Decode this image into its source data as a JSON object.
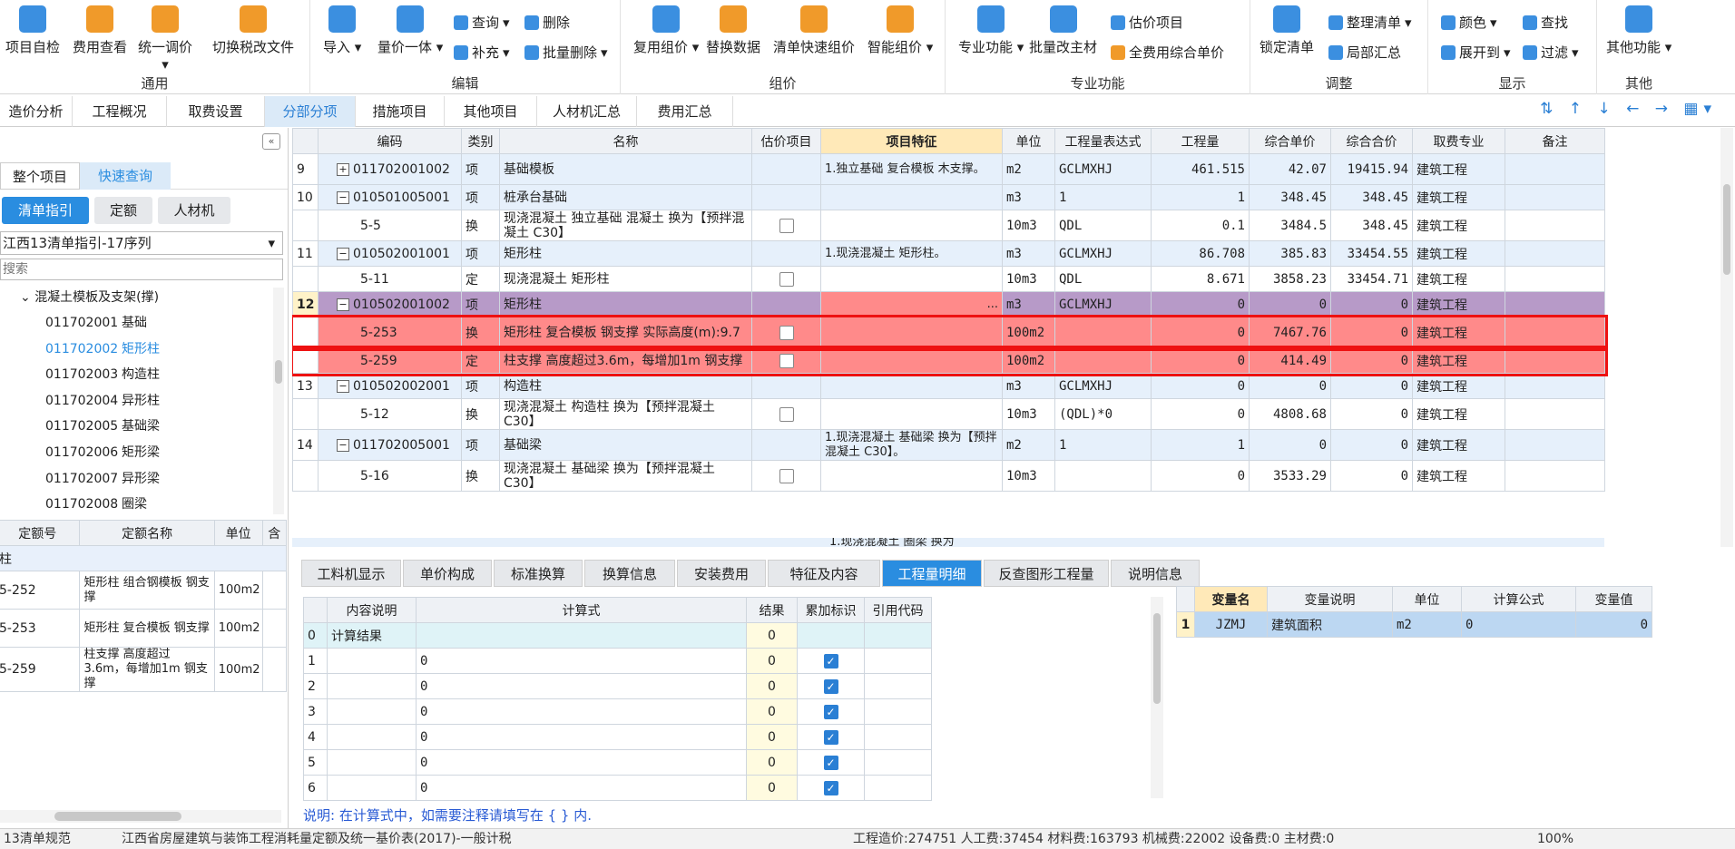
{
  "ribbon": {
    "groups": [
      {
        "label": "通用",
        "buttons": [
          "项目自检",
          "费用查看",
          "统一调价",
          "切换税改文件"
        ]
      },
      {
        "label": "编辑",
        "buttons": [
          "导入",
          "量价一体",
          "查询",
          "删除",
          "补充",
          "批量删除"
        ]
      },
      {
        "label": "组价",
        "buttons": [
          "复用组价",
          "替换数据",
          "清单快速组价",
          "智能组价"
        ]
      },
      {
        "label": "专业功能",
        "buttons": [
          "专业功能",
          "批量改主材",
          "估价项目",
          "全费用综合单价"
        ]
      },
      {
        "label": "调整",
        "buttons": [
          "锁定清单",
          "整理清单",
          "局部汇总"
        ]
      },
      {
        "label": "显示",
        "buttons": [
          "颜色",
          "查找",
          "展开到",
          "过滤"
        ]
      },
      {
        "label": "其他",
        "buttons": [
          "其他功能"
        ]
      }
    ]
  },
  "tabs": [
    "造价分析",
    "工程概况",
    "取费设置",
    "分部分项",
    "措施项目",
    "其他项目",
    "人材机汇总",
    "费用汇总"
  ],
  "left": {
    "toptabs": [
      "整个项目",
      "快速查询"
    ],
    "subtabs": [
      "清单指引",
      "定额",
      "人材机"
    ],
    "select": "江西13清单指引-17序列",
    "search_placeholder": "搜索",
    "tree_root": "混凝土模板及支架(撑)",
    "tree_items": [
      {
        "code": "011702001",
        "name": "基础"
      },
      {
        "code": "011702002",
        "name": "矩形柱"
      },
      {
        "code": "011702003",
        "name": "构造柱"
      },
      {
        "code": "011702004",
        "name": "异形柱"
      },
      {
        "code": "011702005",
        "name": "基础梁"
      },
      {
        "code": "011702006",
        "name": "矩形梁"
      },
      {
        "code": "011702007",
        "name": "异形梁"
      },
      {
        "code": "011702008",
        "name": "圈梁"
      }
    ],
    "quota_headers": [
      "定额号",
      "定额名称",
      "单位",
      "含"
    ],
    "quota_group": "柱",
    "quota_rows": [
      {
        "code": "5-252",
        "name": "矩形柱 组合钢模板 钢支撑",
        "unit": "100m2"
      },
      {
        "code": "5-253",
        "name": "矩形柱 复合模板 钢支撑",
        "unit": "100m2"
      },
      {
        "code": "5-259",
        "name": "柱支撑 高度超过3.6m，每增加1m 钢支撑",
        "unit": "100m2"
      }
    ]
  },
  "main": {
    "headers": [
      "编码",
      "类别",
      "名称",
      "估价项目",
      "项目特征",
      "单位",
      "工程量表达式",
      "工程量",
      "综合单价",
      "综合合价",
      "取费专业",
      "备注"
    ],
    "rows": [
      {
        "no": "9",
        "code": "011702001002",
        "type": "项",
        "name": "基础模板",
        "feature": "1.独立基础 复合模板 木支撑。",
        "unit": "m2",
        "expr": "GCLMXHJ",
        "qty": "461.515",
        "price": "42.07",
        "total": "19415.94",
        "spec": "建筑工程",
        "kind": "item",
        "tall": true
      },
      {
        "no": "10",
        "code": "010501005001",
        "type": "项",
        "name": "桩承台基础",
        "feature": "",
        "unit": "m3",
        "expr": "1",
        "qty": "1",
        "price": "348.45",
        "total": "348.45",
        "spec": "建筑工程",
        "kind": "item"
      },
      {
        "no": "",
        "code": "5-5",
        "type": "换",
        "name": "现浇混凝土 独立基础 混凝土  换为【预拌混凝土 C30】",
        "feature": "",
        "unit": "10m3",
        "expr": "QDL",
        "qty": "0.1",
        "price": "3484.5",
        "total": "348.45",
        "spec": "建筑工程",
        "kind": "sub",
        "tall": true
      },
      {
        "no": "11",
        "code": "010502001001",
        "type": "项",
        "name": "矩形柱",
        "feature": "1.现浇混凝土 矩形柱。",
        "unit": "m3",
        "expr": "GCLMXHJ",
        "qty": "86.708",
        "price": "385.83",
        "total": "33454.55",
        "spec": "建筑工程",
        "kind": "item"
      },
      {
        "no": "",
        "code": "5-11",
        "type": "定",
        "name": "现浇混凝土 矩形柱",
        "feature": "",
        "unit": "10m3",
        "expr": "QDL",
        "qty": "8.671",
        "price": "3858.23",
        "total": "33454.71",
        "spec": "建筑工程",
        "kind": "sub"
      },
      {
        "no": "12",
        "code": "010502001002",
        "type": "项",
        "name": "矩形柱",
        "feature": "...",
        "unit": "m3",
        "expr": "GCLMXHJ",
        "qty": "0",
        "price": "0",
        "total": "0",
        "spec": "建筑工程",
        "kind": "selected"
      },
      {
        "no": "",
        "code": "5-253",
        "type": "换",
        "name": "矩形柱 复合模板 钢支撑  实际高度(m):9.7",
        "feature": "",
        "unit": "100m2",
        "expr": "",
        "qty": "0",
        "price": "7467.76",
        "total": "0",
        "spec": "建筑工程",
        "kind": "hl",
        "tall": true
      },
      {
        "no": "",
        "code": "5-259",
        "type": "定",
        "name": "柱支撑 高度超过3.6m，每增加1m 钢支撑",
        "feature": "",
        "unit": "100m2",
        "expr": "",
        "qty": "0",
        "price": "414.49",
        "total": "0",
        "spec": "建筑工程",
        "kind": "hl"
      },
      {
        "no": "13",
        "code": "010502002001",
        "type": "项",
        "name": "构造柱",
        "feature": "",
        "unit": "m3",
        "expr": "GCLMXHJ",
        "qty": "0",
        "price": "0",
        "total": "0",
        "spec": "建筑工程",
        "kind": "item"
      },
      {
        "no": "",
        "code": "5-12",
        "type": "换",
        "name": "现浇混凝土 构造柱  换为【预拌混凝土 C30】",
        "feature": "",
        "unit": "10m3",
        "expr": "(QDL)*0",
        "qty": "0",
        "price": "4808.68",
        "total": "0",
        "spec": "建筑工程",
        "kind": "sub",
        "tall": true
      },
      {
        "no": "14",
        "code": "011702005001",
        "type": "项",
        "name": "基础梁",
        "feature": "1.现浇混凝土 基础梁  换为【预拌混凝土 C30】。",
        "unit": "m2",
        "expr": "1",
        "qty": "1",
        "price": "0",
        "total": "0",
        "spec": "建筑工程",
        "kind": "item",
        "tall": true
      },
      {
        "no": "",
        "code": "5-16",
        "type": "换",
        "name": "现浇混凝土 基础梁  换为【预拌混凝土 C30】",
        "feature": "",
        "unit": "10m3",
        "expr": "",
        "qty": "0",
        "price": "3533.29",
        "total": "0",
        "spec": "建筑工程",
        "kind": "sub",
        "tall": true
      }
    ],
    "partial_feature": "1.现浇混凝土 圈梁  换为"
  },
  "bottom": {
    "tabs": [
      "工料机显示",
      "单价构成",
      "标准换算",
      "换算信息",
      "安装费用",
      "特征及内容",
      "工程量明细",
      "反查图形工程量",
      "说明信息"
    ],
    "calc_headers": [
      "内容说明",
      "计算式",
      "结果",
      "累加标识",
      "引用代码"
    ],
    "calc_rows": [
      {
        "no": "0",
        "desc": "计算结果",
        "formula": "",
        "result": "0",
        "check": false
      },
      {
        "no": "1",
        "desc": "",
        "formula": "0",
        "result": "0",
        "check": true
      },
      {
        "no": "2",
        "desc": "",
        "formula": "0",
        "result": "0",
        "check": true
      },
      {
        "no": "3",
        "desc": "",
        "formula": "0",
        "result": "0",
        "check": true
      },
      {
        "no": "4",
        "desc": "",
        "formula": "0",
        "result": "0",
        "check": true
      },
      {
        "no": "5",
        "desc": "",
        "formula": "0",
        "result": "0",
        "check": true
      },
      {
        "no": "6",
        "desc": "",
        "formula": "0",
        "result": "0",
        "check": true
      }
    ],
    "note": "说明: 在计算式中，如需要注释请填写在 { } 内.",
    "var_headers": [
      "变量名",
      "变量说明",
      "单位",
      "计算公式",
      "变量值"
    ],
    "var_rows": [
      {
        "no": "1",
        "name": "JZMJ",
        "desc": "建筑面积",
        "unit": "m2",
        "formula": "0",
        "value": "0"
      }
    ]
  },
  "status": {
    "left": "13清单规范",
    "mid": "江西省房屋建筑与装饰工程消耗量定额及统一基价表(2017)-一般计税",
    "right": "工程造价:274751  人工费:37454  材料费:163793  机械费:22002  设备费:0  主材费:0",
    "zoom": "100%"
  }
}
